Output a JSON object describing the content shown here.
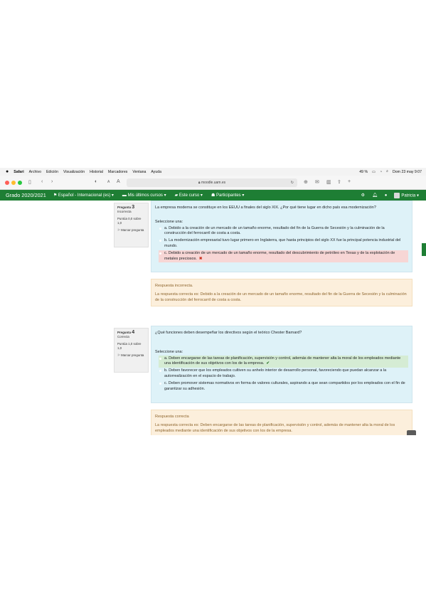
{
  "menubar": {
    "apple": "",
    "items": [
      "Safari",
      "Archivo",
      "Edición",
      "Visualización",
      "Historial",
      "Marcadores",
      "Ventana",
      "Ayuda"
    ],
    "battery": "49 %",
    "datetime": "Dom 23 may  9:07"
  },
  "browser": {
    "url": "moodle.uam.es"
  },
  "navbar": {
    "brand": "Grado 2020/2021",
    "language": "Español - Internacional (es) ▾",
    "recent_courses": "Mis últimos cursos ▾",
    "this_course": "Este curso ▾",
    "participants": "Participantes ▾",
    "user": "Patricia ▾"
  },
  "questions": [
    {
      "label": "Pregunta",
      "number": "3",
      "status": "Incorrecta",
      "score": "Puntúa 0,0 sobre 1,0",
      "flag": "Marcar pregunta",
      "text": "La empresa moderna se constituye en los EEUU a finales del siglo XIX. ¿Por qué tiene lugar en dicho país esa modernización?",
      "prompt": "Seleccione una:",
      "options": [
        "a. Debido a la creación de un mercado de un tamaño enorme, resultado del fin de la Guerra de Secesión y la culminación de la construcción del ferrocarril de costa a costa.",
        "b. La modernización empresarial tuvo lugar primero en Inglaterra, que hasta principios del siglo XX fue la principal potencia industrial del mundo.",
        "c. Debido a creación de un mercado de un tamaño enorme, resultado del descubrimiento de petróleo en Texas y de la explotación de metales preciosos."
      ],
      "feedback_title": "Respuesta incorrecta.",
      "feedback_text": "La respuesta correcta es: Debido a la creación de un mercado de un tamaño enorme, resultado del fin de la Guerra de Secesión y la culminación de la construcción del ferrocarril de costa a costa."
    },
    {
      "label": "Pregunta",
      "number": "4",
      "status": "Correcta",
      "score": "Puntúa 1,0 sobre 1,0",
      "flag": "Marcar pregunta",
      "text": "¿Qué funciones deben desempeñar los directivos según el teórico Chester Barnard?",
      "prompt": "Seleccione una:",
      "options": [
        "a. Deben encargarse de las tareas de planificación, supervisión y control, además de mantener alta la moral de los empleados mediante una identificación de sus objetivos con los de la empresa.",
        "b. Deben favorecer que los empleados cultiven su anhelo interior de desarrollo personal, favoreciendo que puedan alcanzar a la autorrealización en el espacio de trabajo.",
        "c. Deben promover sistemas normativos en forma de valores culturales, aspirando a que sean compartidos por los empleados con el fin de garantizar su adhesión."
      ],
      "feedback_title": "Respuesta correcta",
      "feedback_text": "La respuesta correcta es: Deben encargarse de las tareas de planificación, supervisión y control, además de mantener alta la moral de los empleados mediante una identificación de sus objetivos con los de la empresa."
    }
  ],
  "marks": {
    "wrong": "✖",
    "right": "✔"
  },
  "colors": {
    "navbar": "#1e7e34",
    "question_bg": "#def2f8",
    "feedback_bg": "#fcefdc",
    "wrong_bg": "#f7d6d5",
    "right_bg": "#d5ecd4"
  }
}
